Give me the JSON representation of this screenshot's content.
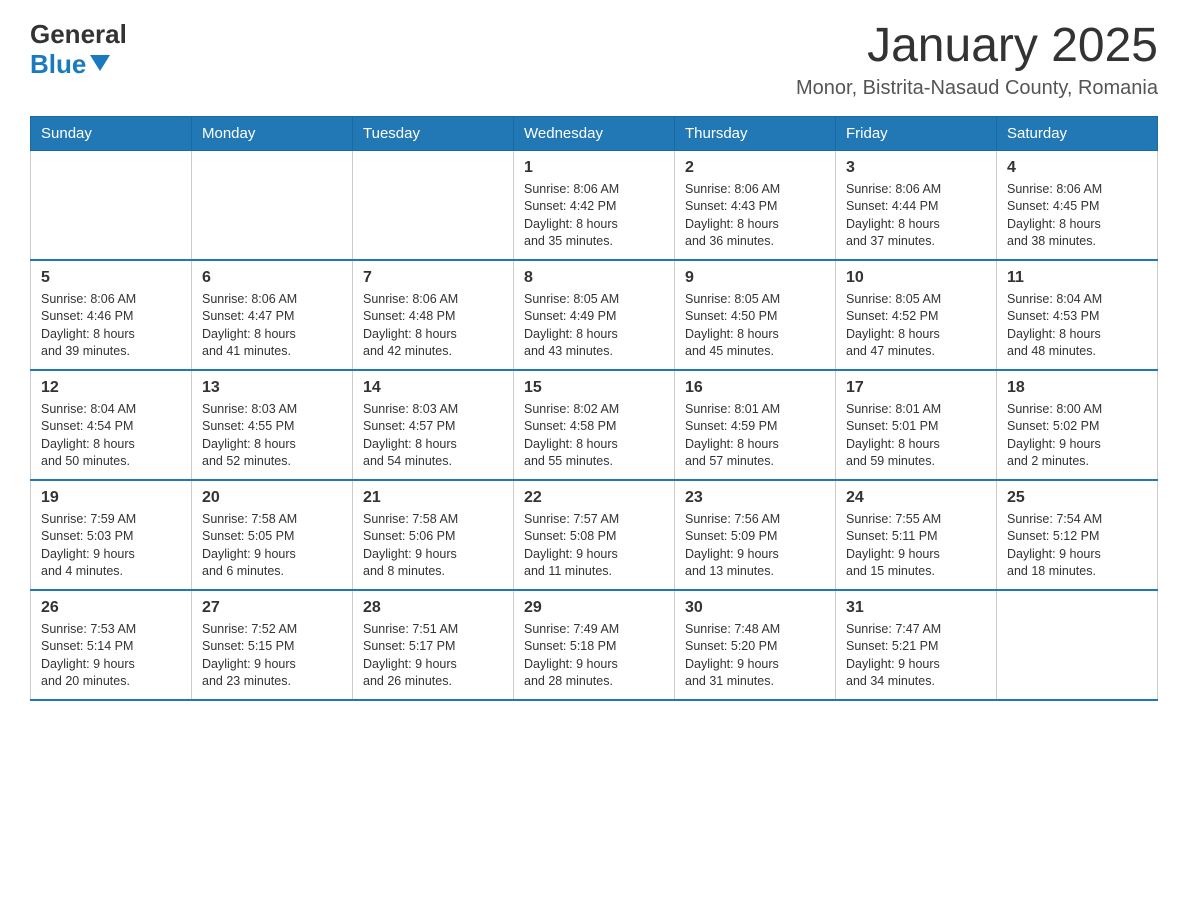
{
  "header": {
    "logo_general": "General",
    "logo_blue": "Blue",
    "month_title": "January 2025",
    "location": "Monor, Bistrita-Nasaud County, Romania"
  },
  "days_of_week": [
    "Sunday",
    "Monday",
    "Tuesday",
    "Wednesday",
    "Thursday",
    "Friday",
    "Saturday"
  ],
  "weeks": [
    [
      {
        "day": "",
        "info": ""
      },
      {
        "day": "",
        "info": ""
      },
      {
        "day": "",
        "info": ""
      },
      {
        "day": "1",
        "info": "Sunrise: 8:06 AM\nSunset: 4:42 PM\nDaylight: 8 hours\nand 35 minutes."
      },
      {
        "day": "2",
        "info": "Sunrise: 8:06 AM\nSunset: 4:43 PM\nDaylight: 8 hours\nand 36 minutes."
      },
      {
        "day": "3",
        "info": "Sunrise: 8:06 AM\nSunset: 4:44 PM\nDaylight: 8 hours\nand 37 minutes."
      },
      {
        "day": "4",
        "info": "Sunrise: 8:06 AM\nSunset: 4:45 PM\nDaylight: 8 hours\nand 38 minutes."
      }
    ],
    [
      {
        "day": "5",
        "info": "Sunrise: 8:06 AM\nSunset: 4:46 PM\nDaylight: 8 hours\nand 39 minutes."
      },
      {
        "day": "6",
        "info": "Sunrise: 8:06 AM\nSunset: 4:47 PM\nDaylight: 8 hours\nand 41 minutes."
      },
      {
        "day": "7",
        "info": "Sunrise: 8:06 AM\nSunset: 4:48 PM\nDaylight: 8 hours\nand 42 minutes."
      },
      {
        "day": "8",
        "info": "Sunrise: 8:05 AM\nSunset: 4:49 PM\nDaylight: 8 hours\nand 43 minutes."
      },
      {
        "day": "9",
        "info": "Sunrise: 8:05 AM\nSunset: 4:50 PM\nDaylight: 8 hours\nand 45 minutes."
      },
      {
        "day": "10",
        "info": "Sunrise: 8:05 AM\nSunset: 4:52 PM\nDaylight: 8 hours\nand 47 minutes."
      },
      {
        "day": "11",
        "info": "Sunrise: 8:04 AM\nSunset: 4:53 PM\nDaylight: 8 hours\nand 48 minutes."
      }
    ],
    [
      {
        "day": "12",
        "info": "Sunrise: 8:04 AM\nSunset: 4:54 PM\nDaylight: 8 hours\nand 50 minutes."
      },
      {
        "day": "13",
        "info": "Sunrise: 8:03 AM\nSunset: 4:55 PM\nDaylight: 8 hours\nand 52 minutes."
      },
      {
        "day": "14",
        "info": "Sunrise: 8:03 AM\nSunset: 4:57 PM\nDaylight: 8 hours\nand 54 minutes."
      },
      {
        "day": "15",
        "info": "Sunrise: 8:02 AM\nSunset: 4:58 PM\nDaylight: 8 hours\nand 55 minutes."
      },
      {
        "day": "16",
        "info": "Sunrise: 8:01 AM\nSunset: 4:59 PM\nDaylight: 8 hours\nand 57 minutes."
      },
      {
        "day": "17",
        "info": "Sunrise: 8:01 AM\nSunset: 5:01 PM\nDaylight: 8 hours\nand 59 minutes."
      },
      {
        "day": "18",
        "info": "Sunrise: 8:00 AM\nSunset: 5:02 PM\nDaylight: 9 hours\nand 2 minutes."
      }
    ],
    [
      {
        "day": "19",
        "info": "Sunrise: 7:59 AM\nSunset: 5:03 PM\nDaylight: 9 hours\nand 4 minutes."
      },
      {
        "day": "20",
        "info": "Sunrise: 7:58 AM\nSunset: 5:05 PM\nDaylight: 9 hours\nand 6 minutes."
      },
      {
        "day": "21",
        "info": "Sunrise: 7:58 AM\nSunset: 5:06 PM\nDaylight: 9 hours\nand 8 minutes."
      },
      {
        "day": "22",
        "info": "Sunrise: 7:57 AM\nSunset: 5:08 PM\nDaylight: 9 hours\nand 11 minutes."
      },
      {
        "day": "23",
        "info": "Sunrise: 7:56 AM\nSunset: 5:09 PM\nDaylight: 9 hours\nand 13 minutes."
      },
      {
        "day": "24",
        "info": "Sunrise: 7:55 AM\nSunset: 5:11 PM\nDaylight: 9 hours\nand 15 minutes."
      },
      {
        "day": "25",
        "info": "Sunrise: 7:54 AM\nSunset: 5:12 PM\nDaylight: 9 hours\nand 18 minutes."
      }
    ],
    [
      {
        "day": "26",
        "info": "Sunrise: 7:53 AM\nSunset: 5:14 PM\nDaylight: 9 hours\nand 20 minutes."
      },
      {
        "day": "27",
        "info": "Sunrise: 7:52 AM\nSunset: 5:15 PM\nDaylight: 9 hours\nand 23 minutes."
      },
      {
        "day": "28",
        "info": "Sunrise: 7:51 AM\nSunset: 5:17 PM\nDaylight: 9 hours\nand 26 minutes."
      },
      {
        "day": "29",
        "info": "Sunrise: 7:49 AM\nSunset: 5:18 PM\nDaylight: 9 hours\nand 28 minutes."
      },
      {
        "day": "30",
        "info": "Sunrise: 7:48 AM\nSunset: 5:20 PM\nDaylight: 9 hours\nand 31 minutes."
      },
      {
        "day": "31",
        "info": "Sunrise: 7:47 AM\nSunset: 5:21 PM\nDaylight: 9 hours\nand 34 minutes."
      },
      {
        "day": "",
        "info": ""
      }
    ]
  ]
}
